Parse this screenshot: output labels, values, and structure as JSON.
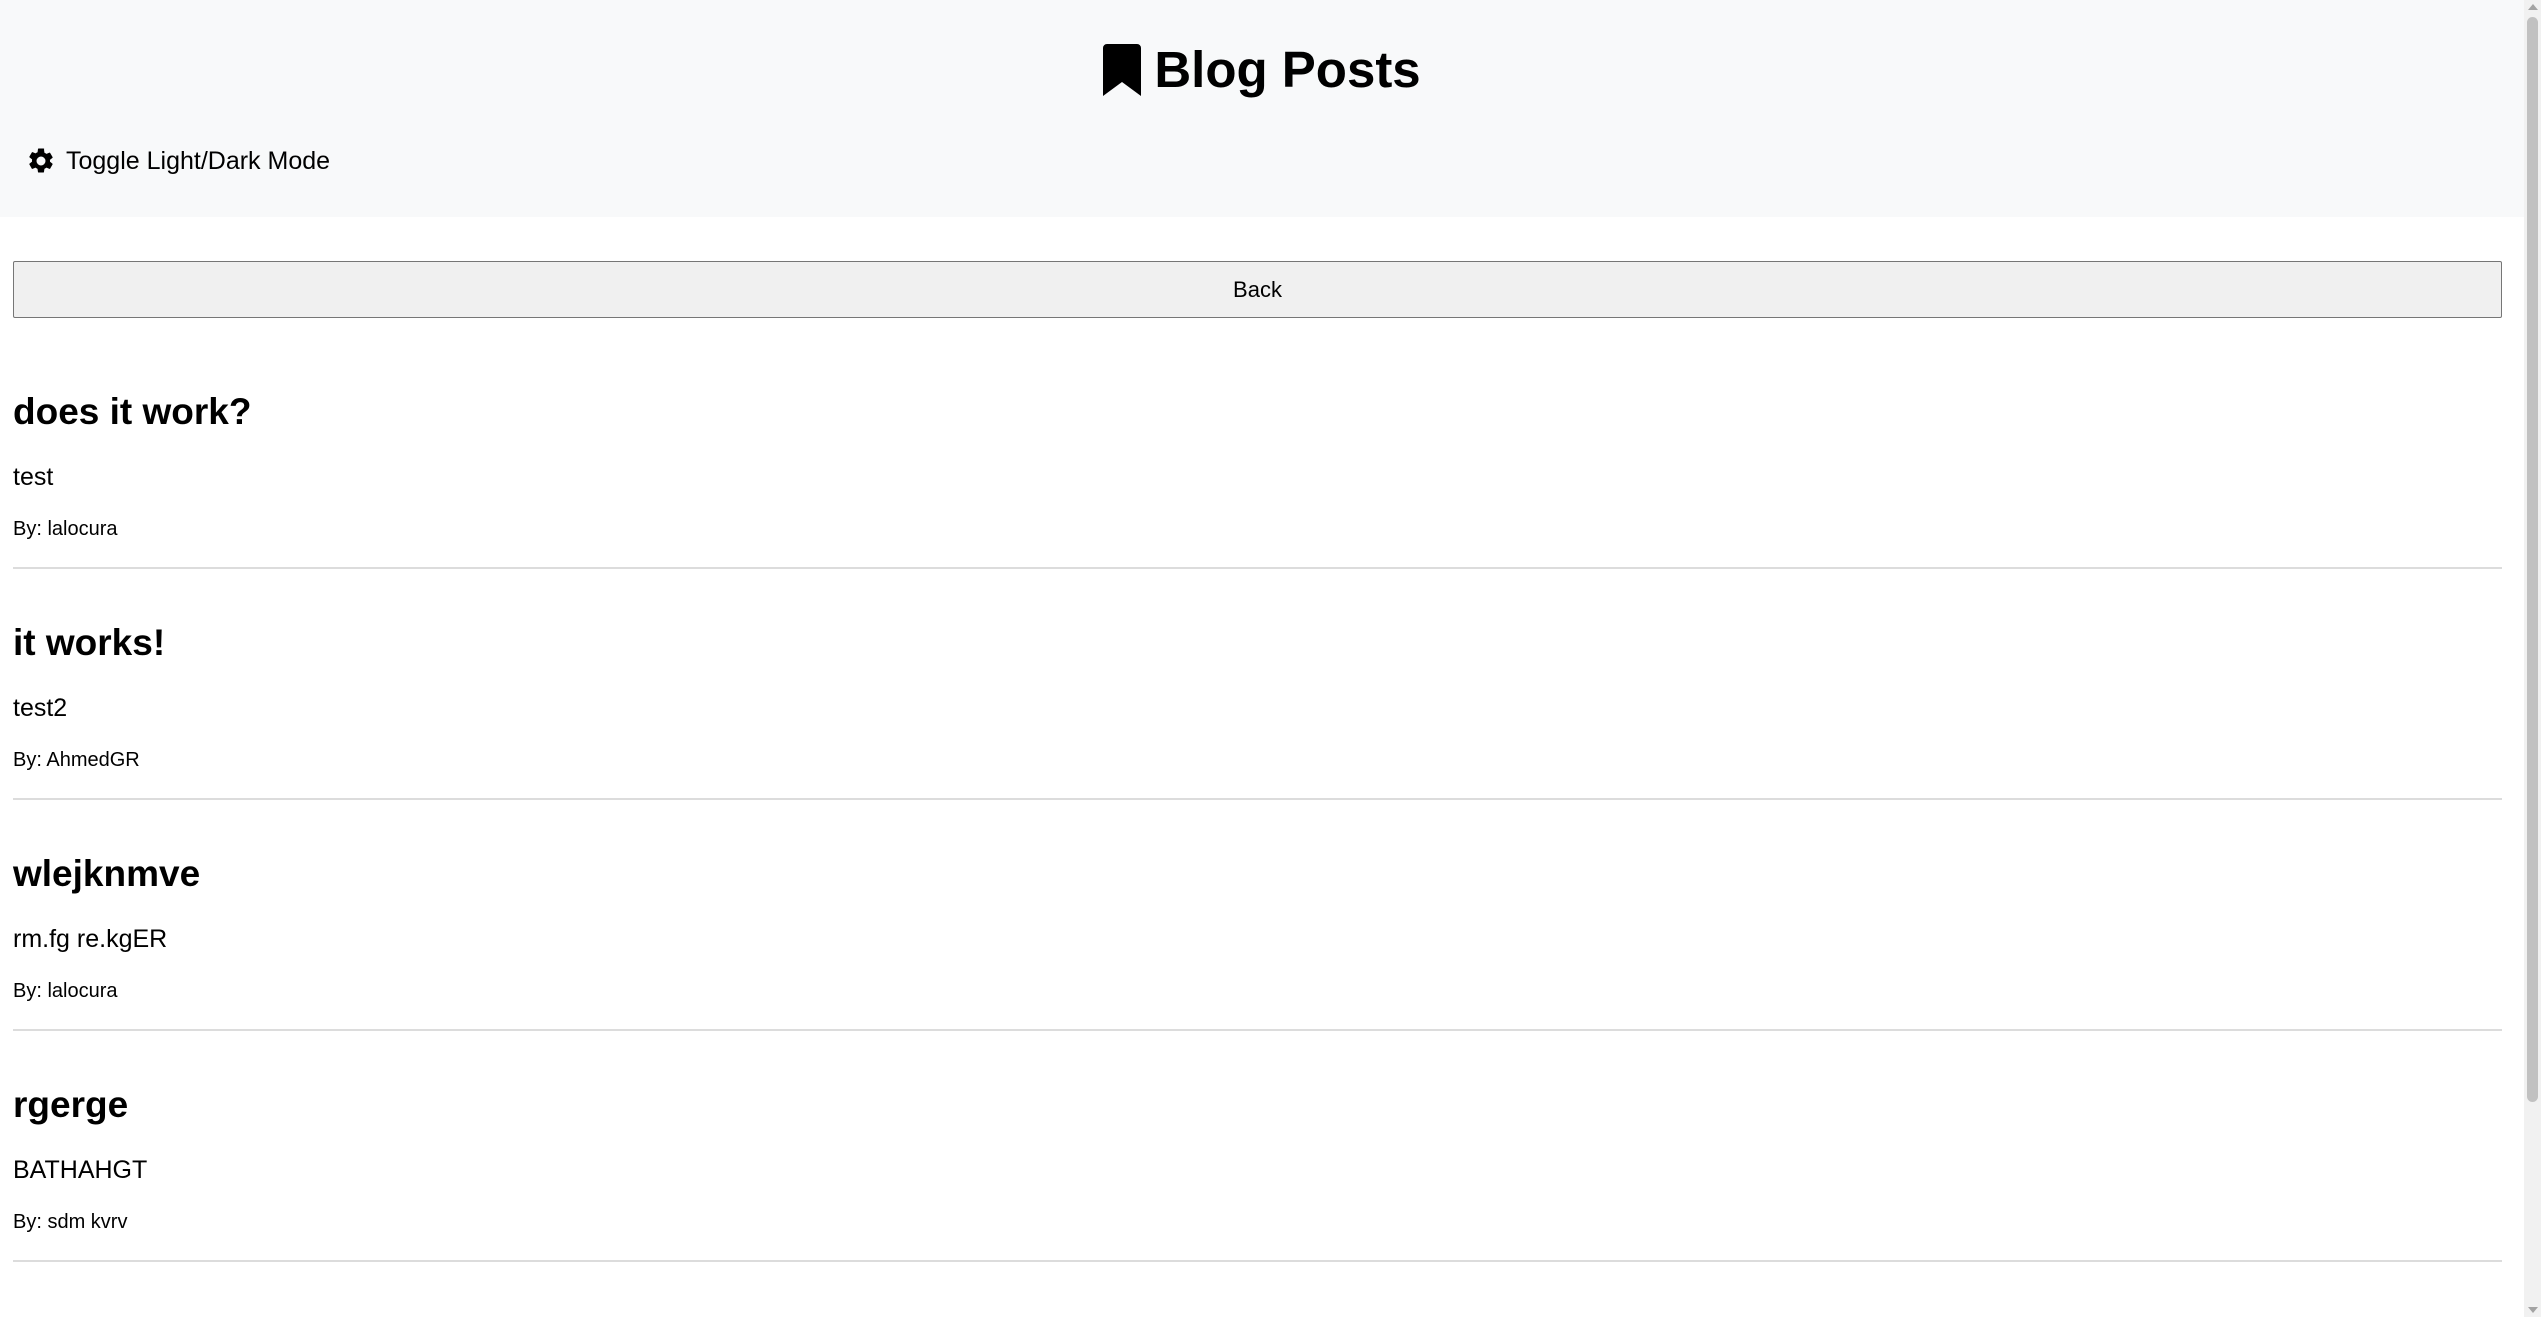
{
  "header": {
    "title": "Blog Posts",
    "title_icon": "bookmark-icon",
    "theme_toggle_label": "Toggle Light/Dark Mode",
    "theme_toggle_icon": "gear-icon"
  },
  "nav": {
    "back_label": "Back"
  },
  "posts": [
    {
      "title": "does it work?",
      "body": "test",
      "author": "By: lalocura"
    },
    {
      "title": "it works!",
      "body": "test2",
      "author": "By: AhmedGR"
    },
    {
      "title": "wlejknmve",
      "body": "rm.fg re.kgER",
      "author": "By: lalocura"
    },
    {
      "title": "rgerge",
      "body": "BATHAHGT",
      "author": "By: sdm kvrv"
    }
  ],
  "colors": {
    "header_background": "#f8f9fa",
    "page_background": "#ffffff",
    "text": "#000000",
    "divider": "#dcdcdc",
    "button_background": "#f0f0f0",
    "button_border": "#767676"
  }
}
